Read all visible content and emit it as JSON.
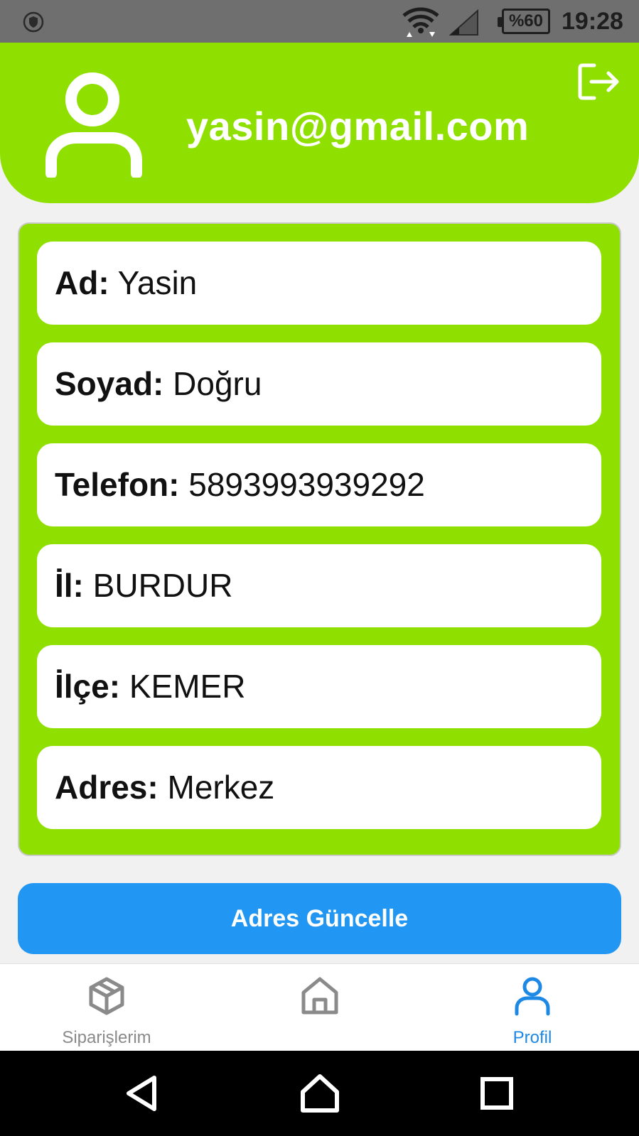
{
  "status_bar": {
    "battery": "%60",
    "time": "19:28",
    "icons": [
      "shield-icon",
      "wifi-icon",
      "signal-icon",
      "battery-icon"
    ]
  },
  "header": {
    "email": "yasin@gmail.com",
    "avatar_icon": "user-icon",
    "logout_icon": "logout-icon"
  },
  "profile": {
    "fields": [
      {
        "label": "Ad:",
        "value": "Yasin"
      },
      {
        "label": "Soyad:",
        "value": "Doğru"
      },
      {
        "label": "Telefon:",
        "value": "5893993939292"
      },
      {
        "label": "İl:",
        "value": "BURDUR"
      },
      {
        "label": "İlçe:",
        "value": "KEMER"
      },
      {
        "label": "Adres:",
        "value": "Merkez"
      }
    ]
  },
  "actions": {
    "update_address": "Adres Güncelle"
  },
  "bottom_nav": {
    "items": [
      {
        "label": "Siparişlerim",
        "icon": "package-icon",
        "active": false
      },
      {
        "label": "",
        "icon": "home-icon",
        "active": false
      },
      {
        "label": "Profil",
        "icon": "user-icon",
        "active": true
      }
    ]
  },
  "system_nav": {
    "icons": [
      "back-icon",
      "home-icon",
      "recents-icon"
    ]
  },
  "colors": {
    "accent_green": "#8fe000",
    "button_blue": "#2196f3",
    "active_nav": "#1e88e5",
    "status_bar": "#6f6f6f"
  }
}
